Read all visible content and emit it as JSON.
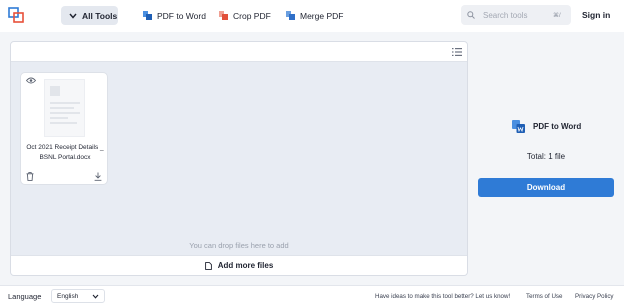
{
  "header": {
    "all_tools_label": "All Tools",
    "nav": [
      {
        "label": "PDF to Word"
      },
      {
        "label": "Crop PDF"
      },
      {
        "label": "Merge PDF"
      }
    ],
    "search_placeholder": "Search tools",
    "search_shortcut": "⌘/",
    "signin_label": "Sign in"
  },
  "workspace": {
    "file": {
      "name_line1": "Oct 2021 Receipt Details _",
      "name_line2": "BSNL Portal.docx"
    },
    "drop_hint": "You can drop files here to add",
    "add_more_label": "Add more files"
  },
  "sidebar": {
    "tool_name": "PDF to Word",
    "total_label": "Total: 1 file",
    "download_label": "Download"
  },
  "footer": {
    "language_label": "Language",
    "language_value": "English",
    "feedback_link": "Have ideas to make this tool better? Let us know!",
    "terms_link": "Terms of Use",
    "privacy_link": "Privacy Policy"
  },
  "colors": {
    "accent": "#2f7bd6",
    "workspace_bg": "#e8ecf3"
  },
  "icons": [
    "app-logo-icon",
    "chevron-down-icon",
    "pdf-to-word-icon",
    "crop-icon",
    "merge-icon",
    "search-icon",
    "list-view-icon",
    "eye-icon",
    "trash-icon",
    "download-icon",
    "file-plus-icon"
  ]
}
